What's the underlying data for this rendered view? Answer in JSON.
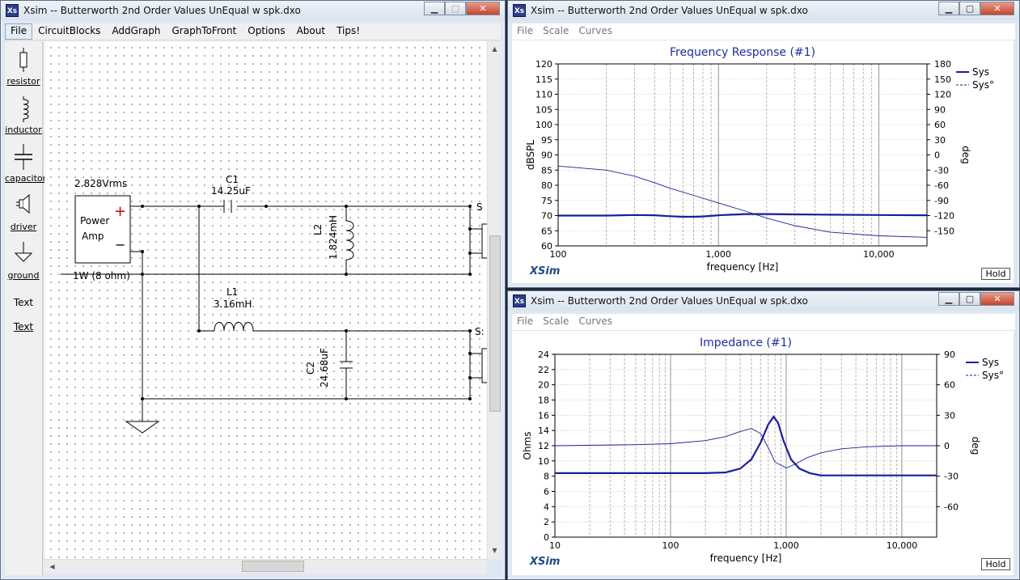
{
  "left_window": {
    "title": "Xsim -- Butterworth 2nd Order Values UnEqual w spk.dxo",
    "icon_text": "Xs",
    "menu": [
      "File",
      "CircuitBlocks",
      "AddGraph",
      "GraphToFront",
      "Options",
      "About",
      "Tips!"
    ],
    "palette": [
      "resistor",
      "inductor",
      "capacitor",
      "driver",
      "ground",
      "Text",
      "Text"
    ],
    "schematic": {
      "source_voltage": "2.828Vrms",
      "source_name_1": "Power",
      "source_name_2": "Amp",
      "source_power": "1W (8 ohm)",
      "plus": "+",
      "minus": "−",
      "c1_name": "C1",
      "c1_value": "14.25uF",
      "l2_name": "L2",
      "l2_value": "1.824mH",
      "l1_name": "L1",
      "l1_value": "3.16mH",
      "c2_name": "C2",
      "c2_value": "24.68uF",
      "s1_name": "S",
      "s2_name": "S:"
    }
  },
  "freq_window": {
    "title": "Xsim -- Butterworth 2nd Order Values UnEqual w spk.dxo",
    "icon_text": "Xs",
    "menu": [
      "File",
      "Scale",
      "Curves"
    ],
    "logo": "XSim",
    "hold": "Hold"
  },
  "imp_window": {
    "title": "Xsim -- Butterworth 2nd Order Values UnEqual w spk.dxo",
    "icon_text": "Xs",
    "menu": [
      "File",
      "Scale",
      "Curves"
    ],
    "logo": "XSim",
    "hold": "Hold"
  },
  "chart_data": [
    {
      "type": "line",
      "title": "Frequency Response (#1)",
      "xlabel": "frequency [Hz]",
      "ylabel": "dBSPL",
      "ylabel_right": "deg",
      "xscale": "log",
      "xlim": [
        100,
        20000
      ],
      "ylim": [
        60,
        120
      ],
      "ylim_right": [
        -180,
        180
      ],
      "x_ticks": [
        "100",
        "1,000",
        "10,000"
      ],
      "y_ticks": [
        "120",
        "115",
        "110",
        "105",
        "100",
        "95",
        "90",
        "85",
        "80",
        "75",
        "70",
        "65",
        "60"
      ],
      "y_ticks_right": [
        "180",
        "150",
        "120",
        "90",
        "60",
        "30",
        "0",
        "-30",
        "-60",
        "-90",
        "-120",
        "-150"
      ],
      "legend": [
        "Sys",
        "Sys°"
      ],
      "legend_position": "right",
      "grid": true,
      "series": [
        {
          "name": "Sys",
          "x": [
            100,
            200,
            300,
            400,
            500,
            600,
            700,
            800,
            1000,
            1200,
            1500,
            2000,
            3000,
            5000,
            10000,
            20000
          ],
          "y": [
            70,
            70,
            70.2,
            70.1,
            69.8,
            69.6,
            69.6,
            69.7,
            70.1,
            70.3,
            70.5,
            70.5,
            70.4,
            70.3,
            70.2,
            70.1
          ]
        },
        {
          "name": "Sys°",
          "axis": "right",
          "x": [
            100,
            200,
            300,
            400,
            500,
            700,
            1000,
            1500,
            2000,
            3000,
            5000,
            10000,
            20000
          ],
          "y": [
            -22,
            -30,
            -42,
            -55,
            -66,
            -80,
            -95,
            -112,
            -125,
            -140,
            -153,
            -160,
            -163
          ]
        }
      ]
    },
    {
      "type": "line",
      "title": "Impedance (#1)",
      "xlabel": "frequency [Hz]",
      "ylabel": "Ohms",
      "ylabel_right": "deg",
      "xscale": "log",
      "xlim": [
        10,
        20000
      ],
      "ylim": [
        0,
        24
      ],
      "ylim_right": [
        -90,
        90
      ],
      "x_ticks": [
        "10",
        "100",
        "1,000",
        "10,000"
      ],
      "y_ticks": [
        "24",
        "22",
        "20",
        "18",
        "16",
        "14",
        "12",
        "10",
        "8",
        "6",
        "4",
        "2",
        "0"
      ],
      "y_ticks_right": [
        "90",
        "60",
        "30",
        "0",
        "-30",
        "-60"
      ],
      "legend": [
        "Sys",
        "Sys°"
      ],
      "legend_position": "right",
      "grid": true,
      "series": [
        {
          "name": "Sys",
          "x": [
            10,
            50,
            100,
            200,
            300,
            400,
            500,
            600,
            700,
            780,
            850,
            950,
            1100,
            1300,
            1600,
            2000,
            3000,
            10000,
            20000
          ],
          "y": [
            8.4,
            8.4,
            8.4,
            8.4,
            8.5,
            9.0,
            10.2,
            12.4,
            14.8,
            15.8,
            15.0,
            12.6,
            10.2,
            9.0,
            8.4,
            8.1,
            8.1,
            8.1,
            8.1
          ]
        },
        {
          "name": "Sys°",
          "axis": "right",
          "x": [
            10,
            50,
            100,
            200,
            300,
            400,
            500,
            600,
            700,
            800,
            1000,
            1200,
            1500,
            2000,
            3000,
            5000,
            10000,
            20000
          ],
          "y": [
            0,
            1,
            2,
            5,
            9,
            14,
            17,
            12,
            -2,
            -16,
            -22,
            -18,
            -12,
            -7,
            -3,
            -1,
            0,
            0
          ]
        }
      ]
    }
  ]
}
